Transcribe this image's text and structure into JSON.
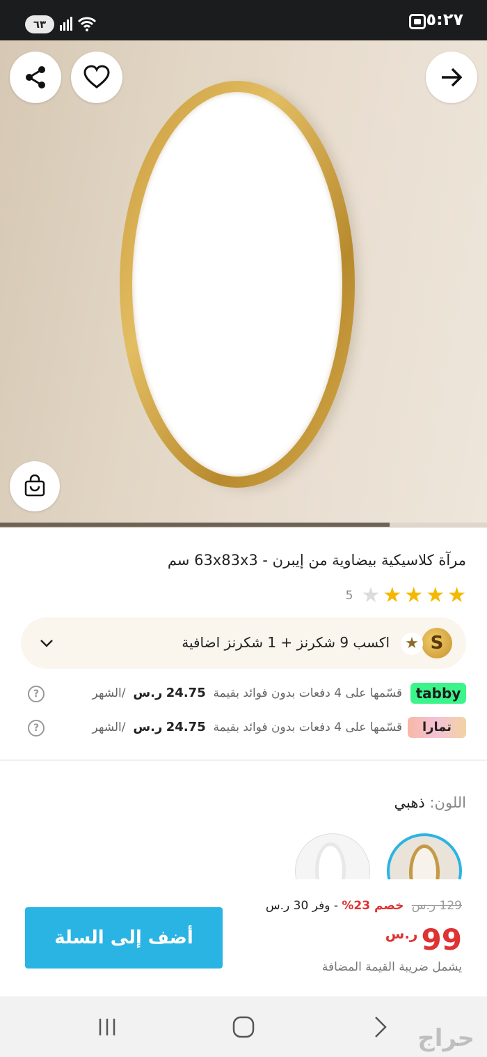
{
  "status_bar": {
    "time": "٥:٢٧",
    "battery": "٦٣"
  },
  "product": {
    "title": "مرآة كلاسيكية بيضاوية من إيبرن - 63x83x3 سم",
    "rating_count": "5",
    "rating_value": 4,
    "rating_max": 5
  },
  "rewards": {
    "text": "اكسب 9 شكرنز + 1 شكرنز اضافية",
    "badge": "S"
  },
  "installments": [
    {
      "provider": "tabby",
      "text": "قسّمها على 4 دفعات بدون فوائد بقيمة",
      "amount": "24.75",
      "currency": "ر.س",
      "per": "/الشهر",
      "help": "?"
    },
    {
      "provider": "تمارا",
      "text": "قسّمها على 4 دفعات بدون فوائد بقيمة",
      "amount": "24.75",
      "currency": "ر.س",
      "per": "/الشهر",
      "help": "?"
    }
  ],
  "color": {
    "label": "اللون:",
    "value": "ذهبي"
  },
  "pricing": {
    "old_price": "129 ر.س",
    "discount": "خصم 23%",
    "saving": "- وفر 30 ر.س",
    "price": "99",
    "currency": "ر.س",
    "vat_note": "يشمل ضريبة القيمة المضافة"
  },
  "actions": {
    "add_to_cart": "أضف إلى السلة"
  },
  "gallery": {
    "progress": 0.2
  },
  "watermark": "حراج",
  "colors": {
    "accent": "#2ab4e4",
    "price_red": "#d33333",
    "star_gold": "#f5b800"
  }
}
